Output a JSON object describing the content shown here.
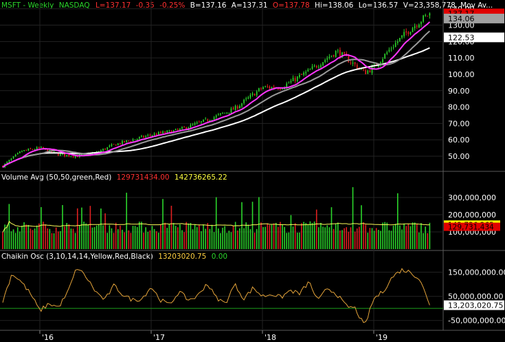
{
  "header": {
    "symbol": "MSFT",
    "sep1": " - ",
    "interval": "Weekly",
    "exchange": "NASDAQ",
    "last": "L=137.17",
    "change": "-0.35",
    "change_pct": "-0.25%",
    "bid": "B=137.16",
    "ask": "A=137.31",
    "open": "O=137.78",
    "high": "Hi=138.06",
    "low": "Lo=136.57",
    "volume": "V=23,358,778",
    "mov_avg": "Mov Av..."
  },
  "volume_header": {
    "label": "Volume Avg (50,50,green,Red)",
    "value1": "129731434.00",
    "value2": "142736265.22"
  },
  "chaikin_header": {
    "label": "Chaikin Osc (3,10,14,14,Yellow,Red,Black)",
    "value1": "13203020.75",
    "value2": "0.00"
  },
  "colors": {
    "up": "#2bd62b",
    "down": "#e02020",
    "ma_short": "#ff35ff",
    "ma_mid": "#9a9a9a",
    "ma_long": "#ffffff",
    "vol_avg": "#ffff5a",
    "osc": "#e5a43a",
    "zero_line": "#1ea01e",
    "grid": "#222222"
  },
  "chart_data": [
    {
      "type": "candlestick",
      "panel": "price",
      "ylim": [
        42,
        142
      ],
      "y_ticks": [
        "140.00",
        "130.00",
        "120.00",
        "110.00",
        "100.00",
        "90.00",
        "80.00",
        "70.00",
        "60.00",
        "50.00"
      ],
      "x_ticks": [
        "'16",
        "'17",
        "'18",
        "'19"
      ],
      "x_range": [
        "2015-09",
        "2019-07"
      ],
      "price_anchors": {
        "x": [
          "2015-09",
          "2015-11",
          "2016-01",
          "2016-03",
          "2016-05",
          "2016-07",
          "2016-09",
          "2016-11",
          "2017-01",
          "2017-04",
          "2017-07",
          "2017-10",
          "2018-01",
          "2018-03",
          "2018-06",
          "2018-09",
          "2018-10",
          "2018-12",
          "2019-01",
          "2019-03",
          "2019-05",
          "2019-07"
        ],
        "close": [
          44,
          53,
          55,
          51,
          50,
          52,
          57,
          60,
          63,
          66,
          72,
          79,
          92,
          92,
          102,
          114,
          110,
          101,
          104,
          117,
          128,
          137.17
        ]
      },
      "markers": [
        {
          "label": "137.17",
          "value": 137.17,
          "color": "#e00000"
        },
        {
          "label": "134.06",
          "value": 134.06,
          "color": "#a0a0a0"
        },
        {
          "label": "122.53",
          "value": 122.53,
          "color": "#ffffff"
        }
      ],
      "series": [
        {
          "legend": "Mov Av...",
          "color": "#ff35ff"
        },
        {
          "color": "#9a9a9a"
        },
        {
          "color": "#ffffff"
        }
      ]
    },
    {
      "type": "bar",
      "panel": "volume",
      "ylim": [
        0,
        400000000
      ],
      "y_ticks": [
        "300,000,000",
        "200,000,000",
        "100,000,000"
      ],
      "markers": [
        {
          "label": "142,736,265",
          "value": 142736265,
          "color": "#ffff00"
        },
        {
          "label": "129,731,434",
          "value": 129731434,
          "color": "#e00000"
        }
      ]
    },
    {
      "type": "line",
      "panel": "chaikin",
      "ylim": [
        -85000000,
        200000000
      ],
      "y_ticks": [
        "150,000,000.00",
        "50,000,000.00",
        "-50,000,000.00"
      ],
      "markers": [
        {
          "label": "13,203,020.75",
          "value": 13203020.75,
          "color": "#ffffff"
        }
      ],
      "anchors": {
        "x": [
          "2015-09",
          "2015-10",
          "2015-11",
          "2015-12",
          "2016-01",
          "2016-02",
          "2016-03",
          "2016-04",
          "2016-05",
          "2016-06",
          "2016-07",
          "2016-08",
          "2016-09",
          "2016-10",
          "2016-11",
          "2016-12",
          "2017-01",
          "2017-02",
          "2017-03",
          "2017-04",
          "2017-05",
          "2017-06",
          "2017-07",
          "2017-08",
          "2017-09",
          "2017-10",
          "2017-11",
          "2017-12",
          "2018-01",
          "2018-02",
          "2018-03",
          "2018-04",
          "2018-05",
          "2018-06",
          "2018-07",
          "2018-08",
          "2018-09",
          "2018-10",
          "2018-11",
          "2018-12",
          "2019-01",
          "2019-02",
          "2019-03",
          "2019-04",
          "2019-05",
          "2019-06",
          "2019-07"
        ],
        "values": [
          30,
          145,
          110,
          60,
          -10,
          20,
          5,
          65,
          170,
          130,
          70,
          35,
          95,
          55,
          35,
          40,
          90,
          35,
          15,
          70,
          35,
          50,
          105,
          45,
          20,
          100,
          40,
          85,
          50,
          60,
          45,
          75,
          60,
          110,
          30,
          85,
          60,
          10,
          0,
          -75,
          40,
          70,
          130,
          160,
          150,
          120,
          13.2
        ]
      }
    }
  ]
}
